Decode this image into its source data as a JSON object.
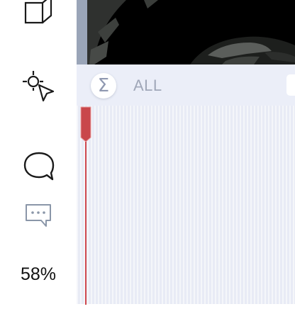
{
  "sidebar": {
    "tools": [
      {
        "icon": "cube-icon",
        "label": ""
      },
      {
        "icon": "target-cursor-icon",
        "label": ""
      },
      {
        "icon": "chat-bubble-icon",
        "label": ""
      },
      {
        "icon": "comment-dots-icon",
        "label": ""
      }
    ],
    "zoom": "58%"
  },
  "timeline": {
    "sigma_symbol": "Σ",
    "filter_label": "ALL",
    "playhead_color": "#d04a4f"
  },
  "colors": {
    "panel_bg": "#e9ecf6",
    "accent_red": "#d04a4f",
    "icon_dark": "#1a1a1a",
    "icon_muted": "#8a96a8"
  }
}
